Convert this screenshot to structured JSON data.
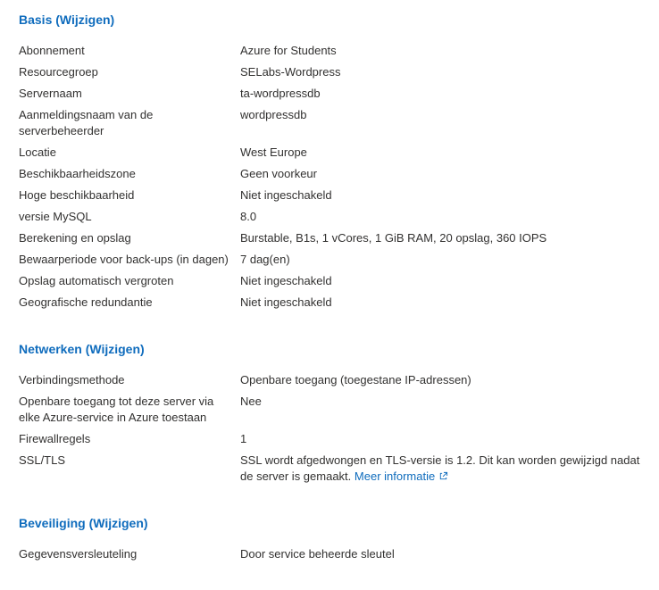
{
  "sections": {
    "basis": {
      "title": "Basis (Wijzigen)",
      "rows": [
        {
          "label": "Abonnement",
          "value": "Azure for Students"
        },
        {
          "label": "Resourcegroep",
          "value": "SELabs-Wordpress"
        },
        {
          "label": "Servernaam",
          "value": "ta-wordpressdb"
        },
        {
          "label": "Aanmeldingsnaam van de serverbeheerder",
          "value": "wordpressdb"
        },
        {
          "label": "Locatie",
          "value": "West Europe"
        },
        {
          "label": "Beschikbaarheidszone",
          "value": "Geen voorkeur"
        },
        {
          "label": "Hoge beschikbaarheid",
          "value": "Niet ingeschakeld"
        },
        {
          "label": "versie MySQL",
          "value": "8.0"
        },
        {
          "label": "Berekening en opslag",
          "value": "Burstable, B1s, 1 vCores, 1 GiB RAM, 20 opslag, 360 IOPS"
        },
        {
          "label": "Bewaarperiode voor back-ups (in dagen)",
          "value": "7 dag(en)"
        },
        {
          "label": "Opslag automatisch vergroten",
          "value": "Niet ingeschakeld"
        },
        {
          "label": "Geografische redundantie",
          "value": "Niet ingeschakeld"
        }
      ]
    },
    "netwerken": {
      "title": "Netwerken (Wijzigen)",
      "rows": [
        {
          "label": "Verbindingsmethode",
          "value": "Openbare toegang (toegestane IP-adressen)"
        },
        {
          "label": "Openbare toegang tot deze server via elke Azure-service in Azure toestaan",
          "value": "Nee"
        },
        {
          "label": "Firewallregels",
          "value": "1"
        },
        {
          "label": "SSL/TLS",
          "value": "SSL wordt afgedwongen en TLS-versie is 1.2. Dit kan worden gewijzigd nadat de server is gemaakt.",
          "link": "Meer informatie"
        }
      ]
    },
    "beveiliging": {
      "title": "Beveiliging (Wijzigen)",
      "rows": [
        {
          "label": "Gegevensversleuteling",
          "value": "Door service beheerde sleutel"
        }
      ]
    }
  },
  "icons": {
    "external_link": "external-link-icon"
  },
  "colors": {
    "link": "#0f6cbd",
    "text": "#323130",
    "background": "#ffffff"
  }
}
